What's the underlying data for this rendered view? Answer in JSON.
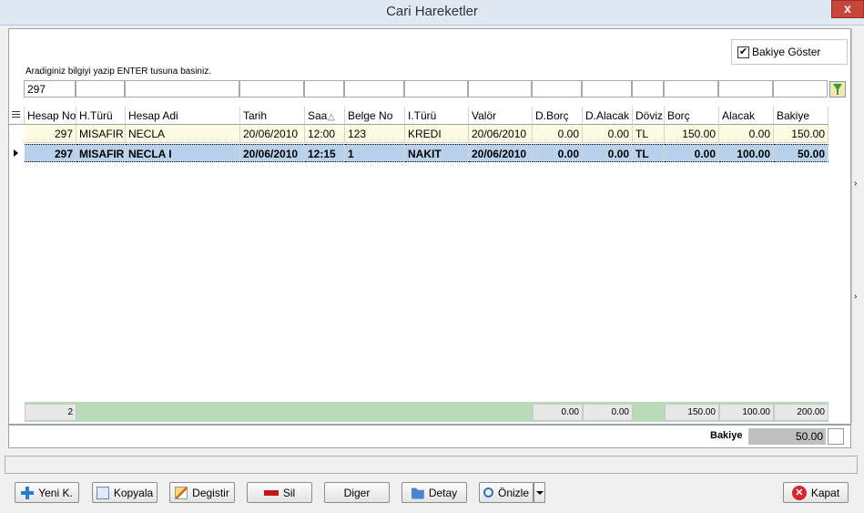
{
  "window": {
    "title": "Cari Hareketler",
    "close_label": "x"
  },
  "hint": "Aradiginiz bilgiyi yazip ENTER tusuna basiniz.",
  "show_balance": {
    "label": "Bakiye Göster",
    "checked": true,
    "check_glyph": "✔"
  },
  "filters": [
    "297",
    "",
    "",
    "",
    "",
    "",
    "",
    "",
    "",
    "",
    "",
    "",
    "",
    ""
  ],
  "columns": [
    "Hesap No",
    "H.Türü",
    "Hesap Adi",
    "Tarih",
    "Saat",
    "Belge No",
    "I.Türü",
    "Valör",
    "D.Borç",
    "D.Alacak",
    "Döviz",
    "Borç",
    "Alacak",
    "Bakiye"
  ],
  "sort_glyph": "△",
  "rows": [
    [
      "297",
      "MISAFIR",
      "NECLA",
      "20/06/2010",
      "12:00",
      "123",
      "KREDI",
      "20/06/2010",
      "0.00",
      "0.00",
      "TL",
      "150.00",
      "0.00",
      "150.00"
    ],
    [
      "297",
      "MISAFIR",
      "NECLA I",
      "20/06/2010",
      "12:15",
      "1",
      "NAKIT",
      "20/06/2010",
      "0.00",
      "0.00",
      "TL",
      "0.00",
      "100.00",
      "50.00"
    ]
  ],
  "footer": {
    "count": "2",
    "d_borc": "0.00",
    "d_alacak": "0.00",
    "borc": "150.00",
    "alacak": "100.00",
    "bakiye": "200.00"
  },
  "balance": {
    "label": "Bakiye",
    "value": "50.00"
  },
  "buttons": {
    "new": "Yeni K.",
    "copy": "Kopyala",
    "edit": "Degistir",
    "delete": "Sil",
    "other": "Diger",
    "detail": "Detay",
    "preview": "Önizle",
    "close": "Kapat"
  },
  "icons": {
    "close_x": "✕",
    "side_arrow": "›"
  }
}
